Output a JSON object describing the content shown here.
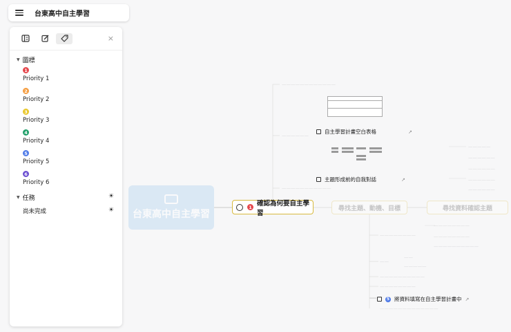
{
  "topbar": {
    "title": "台東高中自主學習"
  },
  "panel": {
    "toolbar_icons": [
      "outline-icon",
      "edit-icon",
      "tag-icon"
    ],
    "close_symbol": "×",
    "icons_section": "圖標",
    "priorities": [
      {
        "num": "1",
        "label": "Priority 1",
        "color": "#e5484d"
      },
      {
        "num": "2",
        "label": "Priority 2",
        "color": "#f59e42"
      },
      {
        "num": "3",
        "label": "Priority 3",
        "color": "#e9c72a"
      },
      {
        "num": "4",
        "label": "Priority 4",
        "color": "#22a06b"
      },
      {
        "num": "5",
        "label": "Priority 5",
        "color": "#4f7be8"
      },
      {
        "num": "6",
        "label": "Priority 6",
        "color": "#6b4fd1"
      }
    ],
    "task_section": "任務",
    "task_filter": "尚未完成",
    "sun_symbol": "☀"
  },
  "map": {
    "root_label": "台東高中自主學習",
    "focus_node": {
      "label": "確認為何要自主學習",
      "priority": "1",
      "priority_color": "#e5484d"
    },
    "side_node_1": "尋找主題、動機、目標",
    "side_node_2": "尋找資料確認主題",
    "task_1": "自主學習計畫空白表格",
    "task_2": "主題形成前的自我對話",
    "task_3": {
      "label": "將資料填寫在自主學習計畫中",
      "priority": "5",
      "priority_color": "#4f7be8"
    },
    "ext_symbol": "↗"
  }
}
